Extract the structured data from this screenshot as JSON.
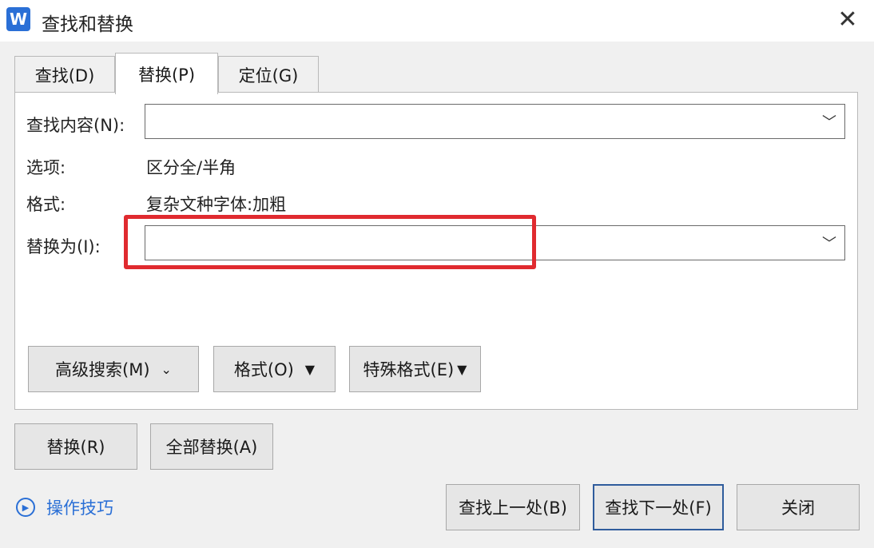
{
  "window": {
    "title": "查找和替换",
    "logo_letter": "W"
  },
  "tabs": [
    {
      "label": "查找(D)"
    },
    {
      "label": "替换(P)"
    },
    {
      "label": "定位(G)"
    }
  ],
  "find": {
    "label": "查找内容(N):",
    "value": ""
  },
  "options": {
    "label": "选项:",
    "value": "区分全/半角"
  },
  "format": {
    "label": "格式:",
    "value": "复杂文种字体:加粗"
  },
  "replace": {
    "label": "替换为(I):",
    "value": ""
  },
  "panel_buttons": {
    "advanced": "高级搜索(M)",
    "format": "格式(O)",
    "special": "特殊格式(E)"
  },
  "actions": {
    "replace": "替换(R)",
    "replace_all": "全部替换(A)",
    "find_prev": "查找上一处(B)",
    "find_next": "查找下一处(F)",
    "close": "关闭"
  },
  "tips": {
    "label": "操作技巧"
  },
  "colors": {
    "accent": "#2a6fd6",
    "highlight": "#e02a2f"
  }
}
